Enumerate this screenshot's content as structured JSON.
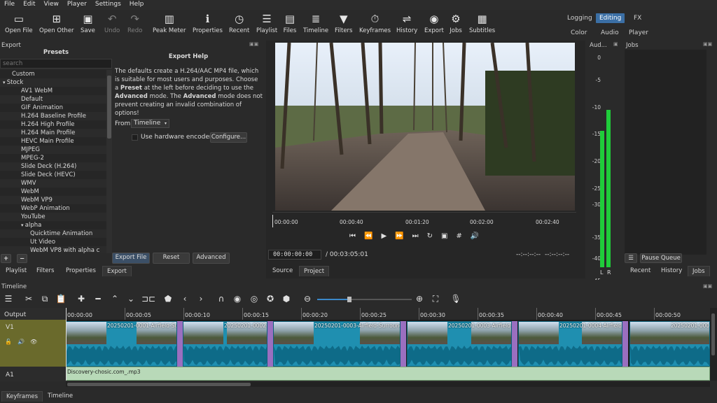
{
  "menu": [
    "File",
    "Edit",
    "View",
    "Player",
    "Settings",
    "Help"
  ],
  "toolbar": {
    "open_file": "Open File",
    "open_other": "Open Other",
    "save": "Save",
    "undo": "Undo",
    "redo": "Redo",
    "peak_meter": "Peak Meter",
    "properties": "Properties",
    "recent": "Recent",
    "playlist": "Playlist",
    "files": "Files",
    "timeline": "Timeline",
    "filters": "Filters",
    "keyframes": "Keyframes",
    "history": "History",
    "export": "Export",
    "jobs": "Jobs",
    "subtitles": "Subtitles"
  },
  "workspaces": {
    "logging": "Logging",
    "editing": "Editing",
    "fx": "FX",
    "color": "Color",
    "audio": "Audio",
    "player": "Player"
  },
  "export_panel": {
    "title": "Export",
    "presets_header": "Presets",
    "search_placeholder": "search",
    "help_title": "Export Help",
    "help_text_1": "The defaults create a H.264/AAC MP4 file, which is suitable for most users and purposes. Choose a ",
    "help_bold_1": "Preset",
    "help_text_2": " at the left before deciding to use the ",
    "help_bold_2": "Advanced",
    "help_text_3": " mode. The ",
    "help_bold_3": "Advanced",
    "help_text_4": " mode does not prevent creating an invalid combination of options!",
    "from_label": "From",
    "from_value": "Timeline",
    "hw_encoder": "Use hardware encoder",
    "configure": "Configure...",
    "export_file": "Export File",
    "reset": "Reset",
    "advanced": "Advanced"
  },
  "presets": [
    {
      "label": "Custom",
      "indent": 1
    },
    {
      "label": "Stock",
      "indent": 0,
      "arrow": "▾"
    },
    {
      "label": "AV1 WebM",
      "indent": 2
    },
    {
      "label": "Default",
      "indent": 2
    },
    {
      "label": "GIF Animation",
      "indent": 2
    },
    {
      "label": "H.264 Baseline Profile",
      "indent": 2
    },
    {
      "label": "H.264 High Profile",
      "indent": 2
    },
    {
      "label": "H.264 Main Profile",
      "indent": 2
    },
    {
      "label": "HEVC Main Profile",
      "indent": 2
    },
    {
      "label": "MJPEG",
      "indent": 2
    },
    {
      "label": "MPEG-2",
      "indent": 2
    },
    {
      "label": "Slide Deck (H.264)",
      "indent": 2
    },
    {
      "label": "Slide Deck (HEVC)",
      "indent": 2
    },
    {
      "label": "WMV",
      "indent": 2
    },
    {
      "label": "WebM",
      "indent": 2
    },
    {
      "label": "WebM VP9",
      "indent": 2
    },
    {
      "label": "WebP Animation",
      "indent": 2
    },
    {
      "label": "YouTube",
      "indent": 2
    },
    {
      "label": "alpha",
      "indent": 2,
      "arrow": "▾"
    },
    {
      "label": "Quicktime Animation",
      "indent": 3
    },
    {
      "label": "Ut Video",
      "indent": 3
    },
    {
      "label": "WebM VP8 with alpha c",
      "indent": 3
    }
  ],
  "left_tabs": [
    "Playlist",
    "Filters",
    "Properties",
    "Export"
  ],
  "player": {
    "ruler": [
      "00:00:00",
      "00:00:40",
      "00:01:20",
      "00:02:00",
      "00:02:40"
    ],
    "timecode": "00:00:00:00",
    "duration": "/ 00:03:05:01",
    "in_point": "--:--:--:--",
    "out_point": "--:--:--:--",
    "tabs": [
      "Source",
      "Project"
    ]
  },
  "audio_meter": {
    "title": "Aud...",
    "scale": [
      "0",
      "-5",
      "-10",
      "-15",
      "-20",
      "-25",
      "-30",
      "-35",
      "-40",
      "-45",
      "-50"
    ],
    "channels": [
      "L",
      "R"
    ],
    "level_left": 0.65,
    "level_right": 0.75
  },
  "jobs": {
    "title": "Jobs",
    "pause_queue": "Pause Queue",
    "tabs": [
      "Recent",
      "History",
      "Jobs"
    ]
  },
  "timeline": {
    "title": "Timeline",
    "output": "Output",
    "track_v1": "V1",
    "track_a1": "A1",
    "ruler": [
      "00:00:00",
      "00:00:05",
      "00:00:10",
      "00:00:15",
      "00:00:20",
      "00:00:25",
      "00:00:30",
      "00:00:35",
      "00:00:40",
      "00:00:45",
      "00:00:50"
    ],
    "clips": [
      "20250201-0001-Airfield-Surro",
      "20250201-0002-Ai",
      "20250201-0003-Airfield-Surrounding",
      "20250201-0003-Airfield-Sur",
      "20250201-0004-Airfield-Su",
      "20250201-0004-Airfield-S"
    ],
    "audio_clip": "Discovery-chosic.com_.mp3"
  },
  "bottom_tabs": [
    "Keyframes",
    "Timeline"
  ]
}
